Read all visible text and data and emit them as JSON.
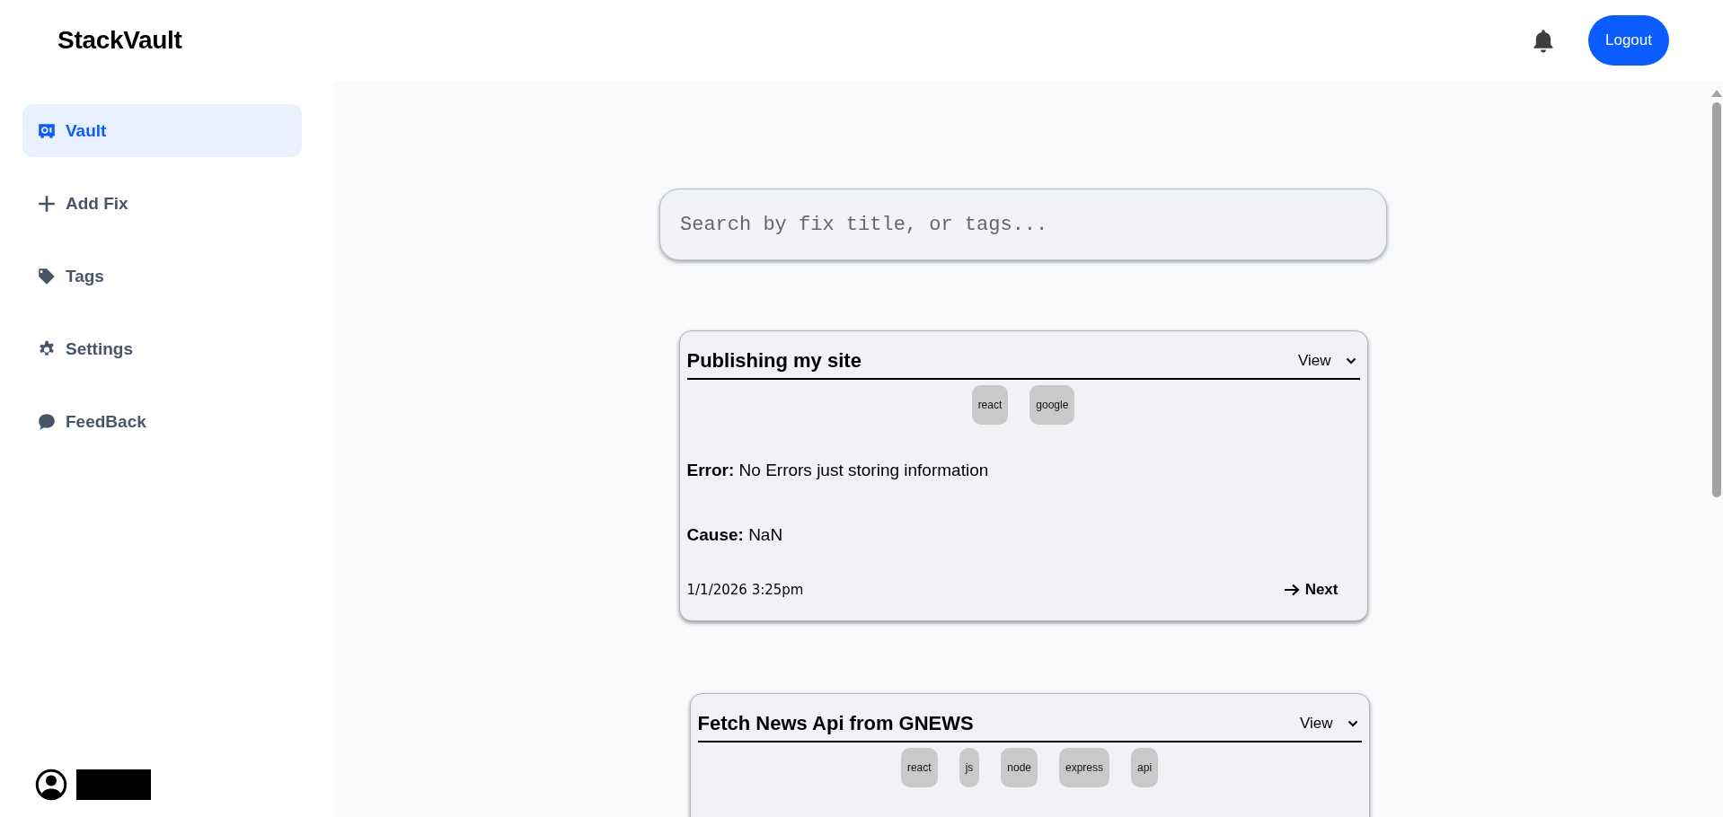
{
  "header": {
    "logo": "StackVault",
    "logout": "Logout"
  },
  "sidebar": {
    "items": [
      {
        "label": "Vault",
        "selected": true
      },
      {
        "label": "Add Fix",
        "selected": false
      },
      {
        "label": "Tags",
        "selected": false
      },
      {
        "label": "Settings",
        "selected": false
      },
      {
        "label": "FeedBack",
        "selected": false
      }
    ]
  },
  "search": {
    "placeholder": "Search by fix title, or tags..."
  },
  "cards": [
    {
      "title": "Publishing my site",
      "view": "View",
      "tags": [
        "react",
        "google"
      ],
      "error_label": "Error:",
      "error": "No Errors just storing information",
      "cause_label": "Cause:",
      "cause": "NaN",
      "date": "1/1/2026 3:25pm",
      "next": "Next"
    },
    {
      "title": "Fetch News Api from GNEWS",
      "view": "View",
      "tags": [
        "react",
        "js",
        "node",
        "express",
        "api"
      ]
    }
  ]
}
